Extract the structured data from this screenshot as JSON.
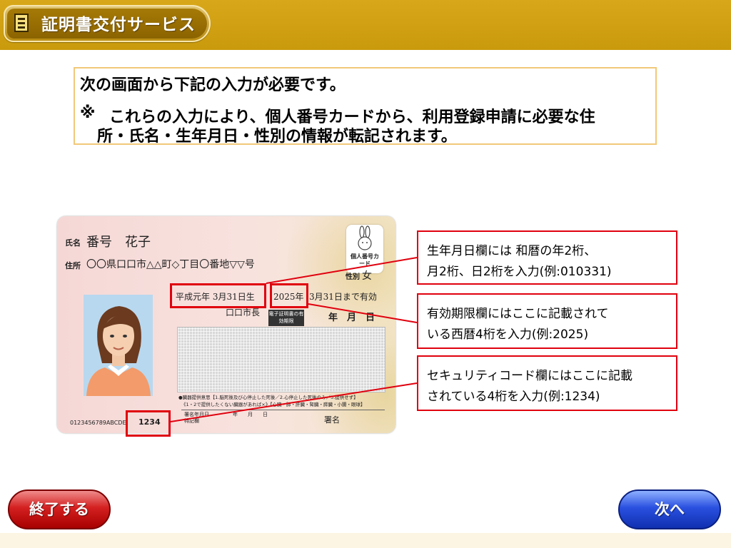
{
  "header": {
    "title": "証明書交付サービス",
    "menu_icon": "menu-list-icon"
  },
  "notice": {
    "line1": "次の画面から下記の入力が必要です。",
    "line2_mark": "※",
    "line2": "これらの入力により、個人番号カードから、利用登録申請に必要な住",
    "line3": "所・氏名・生年月日・性別の情報が転記されます。"
  },
  "card": {
    "name_label": "氏名",
    "name_value": "番号　花子",
    "address_label": "住所",
    "address_value": "〇〇県口口市△△町◇丁目〇番地▽▽号",
    "sex_label": "性別",
    "sex_value": "女",
    "birth_value": "平成元年 3月31日生",
    "expiry_year": "2025年",
    "expiry_rest": "3月31日まで有効",
    "mayor": "口口市長",
    "denshi_label": "電子証明書の有効期限",
    "denshi_date": "年　月　日",
    "badge_text": "個人番号カード",
    "donor_text": "●臓器提供意思【1.脳死後及び心停止した死後／2.心停止した死後のみ／3.提供せず】",
    "donor_sub": "《1・2で提供したくない臓器があれば×》【心臓・肺・肝臓・腎臓・膵臓・小腸・眼球】",
    "sign_date_label": "署名年月日",
    "sign_ymd": "年　　月　　日",
    "sign_label": "署名",
    "special_label": "特記欄",
    "card_number": "0123456789ABCDE",
    "security_code": "1234"
  },
  "callouts": [
    {
      "line1": "生年月日欄には 和暦の年2桁、",
      "line2": "月2桁、日2桁を入力(例:010331)"
    },
    {
      "line1": "有効期限欄にはここに記載されて",
      "line2": "いる西暦4桁を入力(例:2025)"
    },
    {
      "line1": "セキュリティコード欄にはここに記載",
      "line2": "されている4桁を入力(例:1234)"
    }
  ],
  "buttons": {
    "end": "終了する",
    "next": "次へ"
  },
  "colors": {
    "header": "#c99a0c",
    "highlight": "#e0000e",
    "end_button": "#c81818",
    "next_button": "#2446d0"
  }
}
